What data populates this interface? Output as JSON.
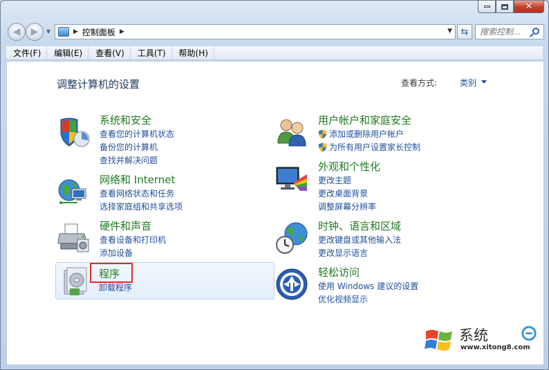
{
  "window": {
    "caption": {
      "minimize": "minimize",
      "maximize": "maximize",
      "close": "close"
    }
  },
  "address_bar": {
    "path": "控制面板",
    "search_placeholder": "搜索控制..."
  },
  "menu": [
    "文件(F)",
    "编辑(E)",
    "查看(V)",
    "工具(T)",
    "帮助(H)"
  ],
  "content": {
    "title": "调整计算机的设置",
    "view_by_label": "查看方式:",
    "view_by_value": "类别"
  },
  "categories": [
    {
      "title": "系统和安全",
      "icon": "shield-security-icon",
      "links": [
        "查看您的计算机状态",
        "备份您的计算机",
        "查找并解决问题"
      ]
    },
    {
      "title": "网络和 Internet",
      "icon": "network-globe-icon",
      "links": [
        "查看网络状态和任务",
        "选择家庭组和共享选项"
      ]
    },
    {
      "title": "硬件和声音",
      "icon": "printer-icon",
      "links": [
        "查看设备和打印机",
        "添加设备"
      ]
    },
    {
      "title": "程序",
      "icon": "programs-icon",
      "links": [
        "卸载程序"
      ]
    },
    {
      "title": "用户帐户和家庭安全",
      "icon": "users-icon",
      "links": [
        "添加或删除用户帐户",
        "为所有用户设置家长控制"
      ]
    },
    {
      "title": "外观和个性化",
      "icon": "monitor-palette-icon",
      "links": [
        "更改主题",
        "更改桌面背景",
        "调整屏幕分辨率"
      ]
    },
    {
      "title": "时钟、语言和区域",
      "icon": "clock-globe-icon",
      "links": [
        "更改键盘或其他输入法",
        "更改显示语言"
      ]
    },
    {
      "title": "轻松访问",
      "icon": "ease-of-access-icon",
      "links": [
        "使用 Windows 建议的设置",
        "优化视频显示"
      ]
    }
  ],
  "watermark": {
    "text": "系统",
    "url": "www.xitong8.com"
  }
}
